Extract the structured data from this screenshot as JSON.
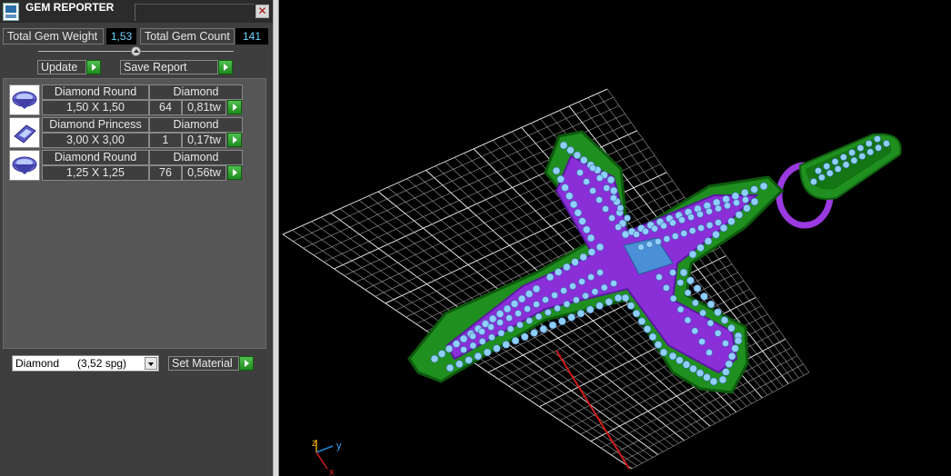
{
  "window": {
    "title": "GEM REPORTER"
  },
  "stats": {
    "weight_label": "Total Gem Weight",
    "weight_value": "1,53",
    "count_label": "Total Gem Count",
    "count_value": "141"
  },
  "actions": {
    "update_label": "Update",
    "save_report_label": "Save Report"
  },
  "gems": [
    {
      "name": "Diamond Round",
      "material": "Diamond",
      "size": "1,50 X 1,50",
      "count": "64",
      "weight": "0,81tw",
      "icon": "round-gem-icon"
    },
    {
      "name": "Diamond Princess",
      "material": "Diamond",
      "size": "3,00 X 3,00",
      "count": "1",
      "weight": "0,17tw",
      "icon": "princess-gem-icon"
    },
    {
      "name": "Diamond Round",
      "material": "Diamond",
      "size": "1,25 X 1,25",
      "count": "76",
      "weight": "0,56tw",
      "icon": "round-gem-icon"
    }
  ],
  "material_select": {
    "value": "Diamond      (3,52 spg)"
  },
  "set_material_label": "Set Material",
  "axes": {
    "z": "z",
    "y": "y",
    "x": "x"
  },
  "colors": {
    "panel_bg": "#3e3e3e",
    "value_text": "#6fd5ff",
    "go_button": "#2ea02e",
    "metal": "#1f8f1f",
    "enamel": "#8a2fd8",
    "gems": "#8ecfff",
    "grid": "#cfcfcf"
  }
}
